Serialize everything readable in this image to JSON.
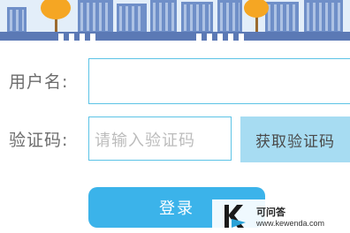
{
  "form": {
    "username_label": "用户名:",
    "username_value": "",
    "code_label": "验证码:",
    "code_placeholder": "请输入验证码",
    "get_code_label": "获取验证码",
    "login_label": "登录"
  },
  "watermark": {
    "title": "可问答",
    "url": "www.kewenda.com"
  },
  "colors": {
    "accent": "#3bb3ea",
    "input_border": "#5cc3e6",
    "code_button": "#a7dcf2",
    "label": "#6c6c6c",
    "banner_building": "#6f8fc8",
    "tree": "#f5a623"
  }
}
